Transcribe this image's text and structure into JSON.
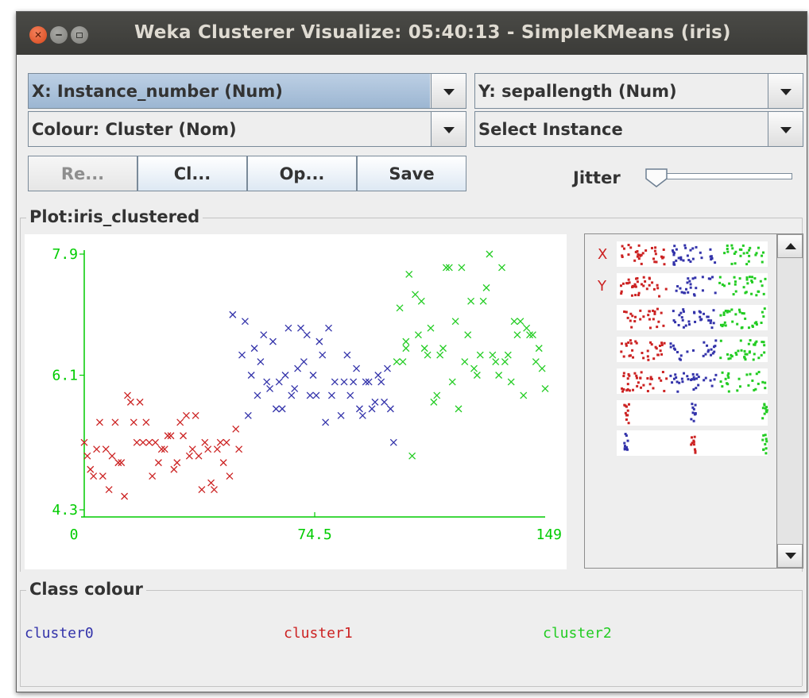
{
  "window": {
    "title": "Weka Clusterer Visualize: 05:40:13 - SimpleKMeans (iris)"
  },
  "controls": {
    "x_axis": "X: Instance_number (Num)",
    "y_axis": "Y: sepallength (Num)",
    "colour": "Colour: Cluster (Nom)",
    "select_instance": "Select Instance",
    "buttons": [
      "Re...",
      "Cl...",
      "Op...",
      "Save"
    ],
    "reset_enabled": false,
    "jitter_label": "Jitter",
    "jitter_value": 0
  },
  "plot": {
    "group_title": "Plot:iris_clustered"
  },
  "matrix": {
    "x_marker": "X",
    "y_marker": "Y"
  },
  "legend": {
    "group_title": "Class colour",
    "items": [
      "cluster0",
      "cluster1",
      "cluster2"
    ]
  },
  "colors": {
    "cluster0": "#3333aa",
    "cluster1": "#cc2222",
    "cluster2": "#22cc22",
    "axis": "#00cc00"
  },
  "chart_data": {
    "type": "scatter",
    "x_tick_labels": [
      "0",
      "74.5",
      "149"
    ],
    "y_tick_labels": [
      "4.3",
      "6.1",
      "7.9"
    ],
    "xlim": [
      0,
      149
    ],
    "ylim": [
      4.3,
      7.9
    ],
    "marker": "x",
    "series": [
      {
        "name": "cluster0",
        "color": "#3333aa",
        "x": [
          48,
          51,
          52,
          55,
          57,
          61,
          60,
          66,
          63,
          70,
          72,
          59,
          53,
          54,
          67,
          69,
          65,
          71,
          62,
          73,
          76,
          79,
          81,
          85,
          87,
          88,
          91,
          93,
          94,
          96,
          98,
          83,
          78,
          75,
          56,
          58,
          64,
          68,
          74,
          77,
          80,
          84,
          86,
          89,
          90,
          92,
          95,
          97,
          99,
          100
        ],
        "y": [
          7.0,
          6.4,
          6.9,
          6.5,
          6.3,
          6.6,
          5.9,
          6.8,
          6.0,
          6.8,
          6.7,
          6.0,
          5.5,
          6.1,
          5.8,
          6.2,
          6.1,
          6.3,
          5.6,
          5.8,
          6.6,
          6.8,
          6.0,
          6.4,
          6.0,
          6.2,
          6.0,
          5.6,
          5.7,
          6.0,
          6.2,
          5.5,
          5.4,
          5.8,
          5.8,
          6.7,
          5.6,
          5.9,
          6.1,
          6.4,
          5.8,
          6.0,
          5.8,
          5.6,
          5.5,
          6.0,
          6.1,
          5.7,
          5.6,
          5.1
        ]
      },
      {
        "name": "cluster1",
        "color": "#cc2222",
        "x": [
          0,
          1,
          2,
          3,
          4,
          5,
          6,
          7,
          8,
          9,
          10,
          11,
          12,
          13,
          14,
          15,
          16,
          17,
          18,
          19,
          20,
          21,
          22,
          23,
          24,
          25,
          26,
          27,
          28,
          29,
          30,
          31,
          32,
          33,
          34,
          35,
          36,
          37,
          38,
          39,
          40,
          41,
          42,
          43,
          44,
          45,
          46,
          47,
          49,
          50
        ],
        "y": [
          5.1,
          4.9,
          4.7,
          4.6,
          5.0,
          5.4,
          4.6,
          5.0,
          4.4,
          4.9,
          5.4,
          4.8,
          4.8,
          4.3,
          5.8,
          5.7,
          5.4,
          5.1,
          5.7,
          5.1,
          5.4,
          5.1,
          4.6,
          5.1,
          4.8,
          5.0,
          5.0,
          5.2,
          5.2,
          4.7,
          4.8,
          5.4,
          5.2,
          5.5,
          4.9,
          5.0,
          5.5,
          4.9,
          4.4,
          5.1,
          5.0,
          4.5,
          4.4,
          5.0,
          5.1,
          4.8,
          5.1,
          4.6,
          5.3,
          5.0
        ]
      },
      {
        "name": "cluster2",
        "color": "#22cc22",
        "x": [
          101,
          102,
          103,
          104,
          105,
          106,
          107,
          108,
          109,
          110,
          111,
          112,
          113,
          114,
          115,
          116,
          117,
          118,
          119,
          120,
          121,
          122,
          123,
          124,
          125,
          126,
          127,
          128,
          129,
          130,
          131,
          132,
          133,
          134,
          135,
          136,
          137,
          138,
          139,
          140,
          141,
          142,
          143,
          144,
          145,
          146,
          147,
          148,
          149,
          104
        ],
        "y": [
          6.3,
          7.1,
          6.3,
          6.5,
          7.6,
          4.9,
          7.3,
          6.7,
          7.2,
          6.5,
          6.4,
          6.8,
          5.7,
          5.8,
          6.4,
          6.5,
          7.7,
          7.7,
          6.0,
          6.9,
          5.6,
          7.7,
          6.3,
          6.7,
          7.2,
          6.2,
          6.1,
          6.4,
          7.2,
          7.4,
          7.9,
          6.4,
          6.3,
          6.1,
          7.7,
          6.3,
          6.4,
          6.0,
          6.9,
          6.7,
          6.9,
          5.8,
          6.8,
          6.7,
          6.7,
          6.3,
          6.5,
          6.2,
          5.9,
          6.6
        ]
      }
    ]
  }
}
